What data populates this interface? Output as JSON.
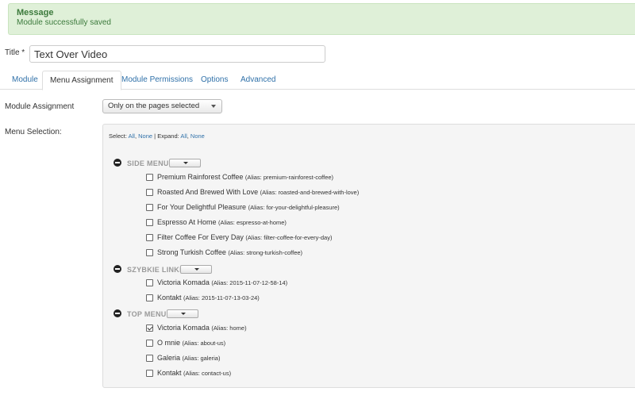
{
  "alert": {
    "heading": "Message",
    "text": "Module successfully saved"
  },
  "title_field": {
    "label": "Title *",
    "value": "Text Over Video"
  },
  "tabs": [
    {
      "label": "Module"
    },
    {
      "label": "Menu Assignment",
      "active": true
    },
    {
      "label": "Module Permissions"
    },
    {
      "label": "Options"
    },
    {
      "label": "Advanced"
    }
  ],
  "module_assignment": {
    "label": "Module Assignment",
    "selected": "Only on the pages selected"
  },
  "menu_selection": {
    "label": "Menu Selection:",
    "select_prefix": "Select:",
    "select_all": "All",
    "select_none": "None",
    "expand_prefix": "Expand:",
    "expand_all": "All",
    "expand_none": "None",
    "separator": "|",
    "groups": [
      {
        "title": "SIDE MENU",
        "items": [
          {
            "name": "Premium Rainforest Coffee",
            "alias": "(Alias: premium-rainforest-coffee)",
            "checked": false
          },
          {
            "name": "Roasted And Brewed With Love",
            "alias": "(Alias: roasted-and-brewed-with-love)",
            "checked": false
          },
          {
            "name": "For Your Delightful Pleasure",
            "alias": "(Alias: for-your-delightful-pleasure)",
            "checked": false
          },
          {
            "name": "Espresso At Home",
            "alias": "(Alias: espresso-at-home)",
            "checked": false
          },
          {
            "name": "Filter Coffee For Every Day",
            "alias": "(Alias: filter-coffee-for-every-day)",
            "checked": false
          },
          {
            "name": "Strong Turkish Coffee",
            "alias": "(Alias: strong-turkish-coffee)",
            "checked": false
          }
        ]
      },
      {
        "title": "SZYBKIE LINKI",
        "items": [
          {
            "name": "Victoria Komada",
            "alias": "(Alias: 2015-11-07-12-58-14)",
            "checked": false
          },
          {
            "name": "Kontakt",
            "alias": "(Alias: 2015-11-07-13-03-24)",
            "checked": false
          }
        ]
      },
      {
        "title": "TOP MENU",
        "items": [
          {
            "name": "Victoria Komada",
            "alias": "(Alias: home)",
            "checked": true
          },
          {
            "name": "O mnie",
            "alias": "(Alias: about-us)",
            "checked": false
          },
          {
            "name": "Galeria",
            "alias": "(Alias: galeria)",
            "checked": false
          },
          {
            "name": "Kontakt",
            "alias": "(Alias: contact-us)",
            "checked": false
          }
        ]
      }
    ]
  }
}
